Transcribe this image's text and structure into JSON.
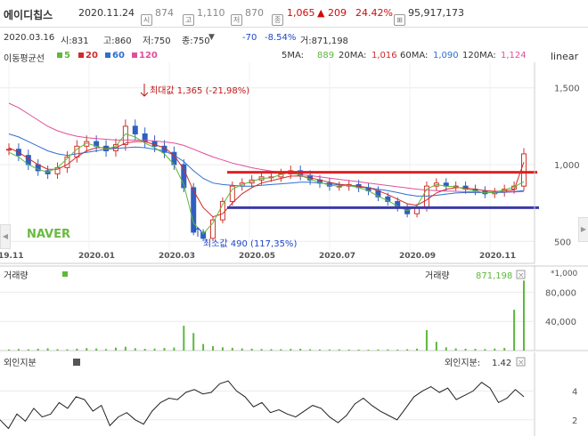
{
  "header": {
    "name": "에이디칩스",
    "date": "2020.11.24",
    "icon_si": "시",
    "open": "874",
    "icon_go": "고",
    "high": "1,110",
    "icon_jeo": "저",
    "low": "870",
    "icon_jong": "종",
    "close": "1,065",
    "change": "▲ 209",
    "change_pct": "24.42%",
    "volume": "95,917,173"
  },
  "info": {
    "date": "2020.03.16",
    "si": "시:831",
    "go": "고:860",
    "jeo": "저:750",
    "jong": "종:750",
    "dropdown": "▼",
    "diff": "-70",
    "pct": "-8.54%",
    "geo": "거:871,198"
  },
  "ma_legend": {
    "title": "이동평균선",
    "items": [
      {
        "label": "5",
        "color": "#5db83a"
      },
      {
        "label": "20",
        "color": "#d22a2a"
      },
      {
        "label": "60",
        "color": "#2f6fd0"
      },
      {
        "label": "120",
        "color": "#e0509a"
      }
    ],
    "values": [
      {
        "label": "5MA:",
        "value": "889",
        "color": "#5db83a"
      },
      {
        "label": "20MA:",
        "value": "1,016",
        "color": "#d22a2a"
      },
      {
        "label": "60MA:",
        "value": "1,090",
        "color": "#2f6fd0"
      },
      {
        "label": "120MA:",
        "value": "1,124",
        "color": "#e0509a"
      }
    ],
    "scale": "linear"
  },
  "annotations": {
    "max": "최대값 1,365 (-21,98%)",
    "min": "최소값 490 (117,35%)",
    "watermark": "NAVER"
  },
  "volume_panel": {
    "title": "거래량",
    "label": "거래량",
    "value": "871,198",
    "multiplier": "*1,000",
    "close_icon": "×"
  },
  "foreign_panel": {
    "title": "외인지분",
    "label": "외인지분:",
    "value": "1.42",
    "close_icon": "×"
  },
  "chart_data": [
    {
      "type": "candlestick",
      "x_ticks": [
        "19.11",
        "2020.01",
        "2020.03",
        "2020.05",
        "2020.07",
        "2020.09",
        "2020.11"
      ],
      "y_ticks": [
        500,
        1000,
        1500
      ],
      "y_tick_labels": [
        "500",
        "1,000",
        "1,500"
      ],
      "ylim": [
        380,
        1620
      ],
      "price": [
        1100,
        1060,
        1000,
        960,
        940,
        980,
        1050,
        1120,
        1150,
        1120,
        1090,
        1130,
        1250,
        1200,
        1150,
        1120,
        1080,
        1000,
        850,
        560,
        520,
        640,
        760,
        860,
        880,
        900,
        920,
        920,
        940,
        960,
        930,
        900,
        880,
        860,
        860,
        870,
        850,
        830,
        790,
        760,
        720,
        680,
        720,
        860,
        880,
        860,
        860,
        840,
        830,
        810,
        820,
        840,
        860,
        1070
      ],
      "ma5": [
        1080,
        1050,
        1000,
        970,
        950,
        980,
        1040,
        1100,
        1140,
        1120,
        1100,
        1120,
        1200,
        1180,
        1140,
        1110,
        1070,
        1000,
        870,
        620,
        550,
        620,
        740,
        840,
        870,
        890,
        910,
        915,
        935,
        950,
        930,
        905,
        885,
        865,
        860,
        865,
        850,
        830,
        795,
        765,
        730,
        700,
        730,
        840,
        870,
        860,
        855,
        840,
        830,
        815,
        820,
        835,
        855,
        889
      ],
      "ma20": [
        1110,
        1080,
        1040,
        1000,
        970,
        970,
        1000,
        1050,
        1090,
        1110,
        1110,
        1110,
        1140,
        1150,
        1150,
        1130,
        1110,
        1060,
        970,
        830,
        720,
        660,
        680,
        750,
        810,
        850,
        880,
        895,
        910,
        925,
        925,
        915,
        900,
        885,
        872,
        866,
        860,
        850,
        830,
        805,
        775,
        745,
        735,
        770,
        815,
        840,
        850,
        848,
        840,
        830,
        826,
        828,
        836,
        1016
      ],
      "ma60": [
        1200,
        1180,
        1150,
        1120,
        1090,
        1070,
        1060,
        1070,
        1080,
        1090,
        1100,
        1105,
        1110,
        1115,
        1110,
        1100,
        1090,
        1060,
        1020,
        960,
        910,
        880,
        870,
        865,
        860,
        860,
        865,
        870,
        875,
        880,
        885,
        885,
        880,
        875,
        868,
        862,
        855,
        848,
        840,
        830,
        818,
        805,
        795,
        795,
        800,
        808,
        815,
        818,
        818,
        818,
        818,
        820,
        825,
        830
      ],
      "ma120": [
        1400,
        1370,
        1330,
        1290,
        1250,
        1220,
        1200,
        1185,
        1175,
        1170,
        1165,
        1160,
        1160,
        1160,
        1158,
        1154,
        1148,
        1140,
        1125,
        1100,
        1075,
        1050,
        1030,
        1010,
        995,
        980,
        968,
        958,
        950,
        942,
        935,
        928,
        920,
        912,
        904,
        896,
        888,
        880,
        872,
        864,
        856,
        848,
        840,
        834,
        830,
        828,
        826,
        824,
        822,
        820,
        820,
        820,
        822,
        825
      ],
      "resistance": 950,
      "support": 720
    },
    {
      "type": "bar",
      "title": "거래량",
      "y_ticks": [
        40000,
        80000
      ],
      "y_tick_labels": [
        "40,000",
        "80,000"
      ],
      "ylim": [
        0,
        100000
      ],
      "values": [
        1500,
        2200,
        1800,
        2500,
        3100,
        2000,
        1700,
        2600,
        3400,
        2900,
        2100,
        4000,
        5200,
        3300,
        2400,
        2800,
        3600,
        4200,
        34000,
        24000,
        9000,
        6000,
        4500,
        3800,
        3000,
        2600,
        2200,
        2000,
        1900,
        2300,
        2500,
        1800,
        1600,
        1500,
        1700,
        1400,
        1300,
        1200,
        1500,
        1600,
        1400,
        1800,
        2600,
        28000,
        12000,
        4500,
        3000,
        2500,
        2300,
        2100,
        2800,
        3600,
        56000,
        95917
      ]
    },
    {
      "type": "line",
      "title": "외인지분",
      "y_ticks": [
        2,
        4
      ],
      "y_tick_labels": [
        "2",
        "4"
      ],
      "ylim": [
        1.0,
        5.2
      ],
      "values": [
        2.0,
        1.4,
        2.4,
        1.9,
        2.8,
        2.2,
        2.4,
        3.2,
        2.8,
        3.6,
        3.4,
        2.6,
        3.0,
        1.6,
        2.2,
        2.5,
        2.0,
        1.7,
        2.6,
        3.2,
        3.5,
        3.4,
        3.9,
        4.1,
        3.8,
        3.9,
        4.5,
        4.7,
        4.0,
        3.6,
        2.9,
        3.2,
        2.5,
        2.7,
        2.4,
        2.2,
        2.6,
        3.0,
        2.8,
        2.2,
        1.8,
        2.3,
        3.1,
        3.5,
        3.0,
        2.6,
        2.3,
        2.0,
        2.8,
        3.6,
        4.0,
        4.3,
        3.9,
        4.2,
        3.4,
        3.7,
        4.0,
        4.6,
        4.2,
        3.2,
        3.5,
        4.1,
        3.6
      ]
    }
  ]
}
